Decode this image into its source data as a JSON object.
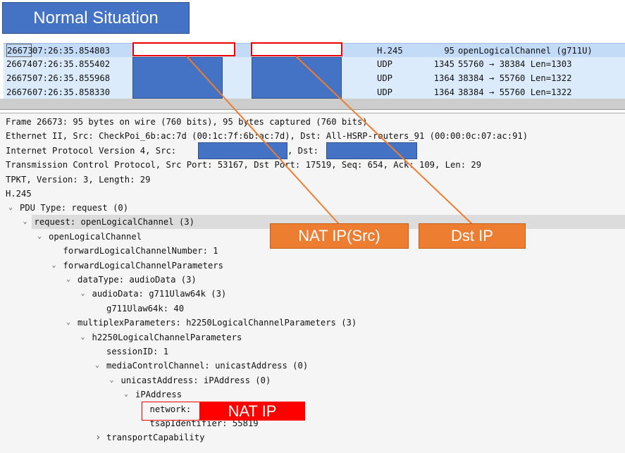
{
  "annotation": {
    "title": "Normal Situation",
    "nat_src_label": "NAT IP(Src)",
    "dst_label": "Dst IP",
    "nat_ip_label": "NAT IP",
    "colors": {
      "title": "#4472c4",
      "callout": "#ed7d31",
      "redact": "#4472c4",
      "alert": "#ff0000"
    }
  },
  "packets": [
    {
      "no": "26673",
      "time": "07:26:35.854803",
      "protocol": "H.245",
      "length": "95",
      "info": "openLogicalChannel (g711U)"
    },
    {
      "no": "26674",
      "time": "07:26:35.855402",
      "protocol": "UDP",
      "length": "1345",
      "info": "55760 → 38384 Len=1303"
    },
    {
      "no": "26675",
      "time": "07:26:35.855968",
      "protocol": "UDP",
      "length": "1364",
      "info": "38384 → 55760 Len=1322"
    },
    {
      "no": "26676",
      "time": "07:26:35.858330",
      "protocol": "UDP",
      "length": "1364",
      "info": "38384 → 55760 Len=1322"
    }
  ],
  "details": {
    "frame": "Frame 26673: 95 bytes on wire (760 bits), 95 bytes captured (760 bits)",
    "ethernet": "Ethernet II, Src: CheckPoi_6b:ac:7d (00:1c:7f:6b:ac:7d), Dst: All-HSRP-routers_91 (00:00:0c:07:ac:91)",
    "ip_prefix": "Internet Protocol Version 4, Src:",
    "ip_dst": ", Dst:",
    "tcp": "Transmission Control Protocol, Src Port: 53167, Dst Port: 17519, Seq: 654, Ack: 109, Len: 29",
    "tpkt": "TPKT, Version: 3, Length: 29",
    "h245": "H.245"
  },
  "tree": [
    {
      "label": "PDU Type: request (0)",
      "level": 0,
      "state": "expanded"
    },
    {
      "label": "request: openLogicalChannel (3)",
      "level": 1,
      "state": "expanded",
      "selected": true
    },
    {
      "label": "openLogicalChannel",
      "level": 2,
      "state": "expanded"
    },
    {
      "label": "forwardLogicalChannelNumber: 1",
      "level": 3,
      "state": "leaf"
    },
    {
      "label": "forwardLogicalChannelParameters",
      "level": 3,
      "state": "expanded"
    },
    {
      "label": "dataType: audioData (3)",
      "level": 4,
      "state": "expanded"
    },
    {
      "label": "audioData: g711Ulaw64k (3)",
      "level": 5,
      "state": "expanded"
    },
    {
      "label": "g711Ulaw64k: 40",
      "level": 6,
      "state": "leaf"
    },
    {
      "label": "multiplexParameters: h2250LogicalChannelParameters (3)",
      "level": 4,
      "state": "expanded"
    },
    {
      "label": "h2250LogicalChannelParameters",
      "level": 5,
      "state": "expanded"
    },
    {
      "label": "sessionID: 1",
      "level": 6,
      "state": "leaf"
    },
    {
      "label": "mediaControlChannel: unicastAddress (0)",
      "level": 6,
      "state": "expanded"
    },
    {
      "label": "unicastAddress: iPAddress (0)",
      "level": 7,
      "state": "expanded"
    },
    {
      "label": "iPAddress",
      "level": 8,
      "state": "expanded"
    },
    {
      "label": "network:",
      "level": 9,
      "state": "leaf"
    },
    {
      "label": "tsapIdentifier: 55819",
      "level": 9,
      "state": "leaf"
    },
    {
      "label": "transportCapability",
      "level": 6,
      "state": "collapsed"
    }
  ]
}
